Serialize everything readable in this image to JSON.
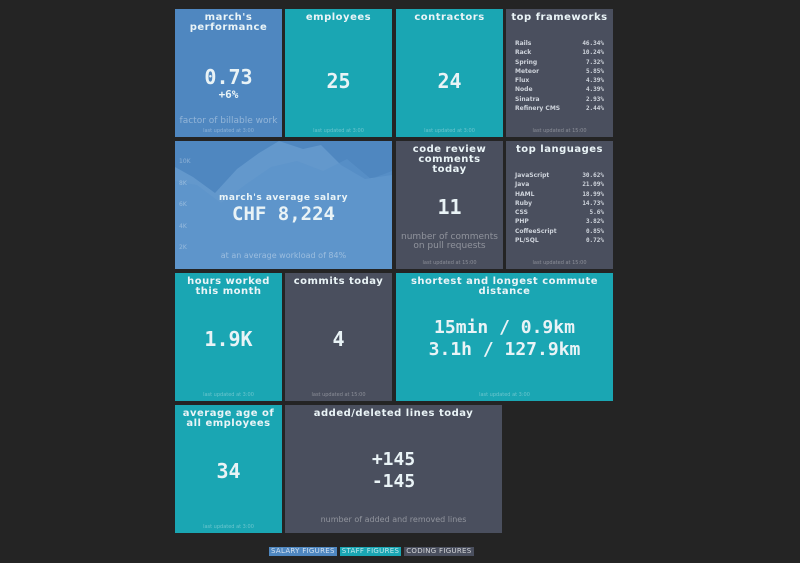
{
  "colors": {
    "salary": "#4f87c0",
    "staff": "#1aa6b3",
    "coding": "#4a4f5e",
    "background": "#242424"
  },
  "performance": {
    "title": "March's Performance",
    "value": "0.73",
    "change": "+6%",
    "moreinfo": "Factor of billable work",
    "updated": "Last updated at 3:00"
  },
  "employees": {
    "title": "Employees",
    "value": "25",
    "updated": "Last updated at 3:00"
  },
  "contractors": {
    "title": "Contractors",
    "value": "24",
    "updated": "Last updated at 3:00"
  },
  "frameworks": {
    "title": "Top Frameworks",
    "items": [
      {
        "label": "Rails",
        "value": "46.34%"
      },
      {
        "label": "Rack",
        "value": "10.24%"
      },
      {
        "label": "Spring",
        "value": "7.32%"
      },
      {
        "label": "Meteor",
        "value": "5.85%"
      },
      {
        "label": "Flux",
        "value": "4.39%"
      },
      {
        "label": "Node",
        "value": "4.39%"
      },
      {
        "label": "Sinatra",
        "value": "2.93%"
      },
      {
        "label": "Refinery CMS",
        "value": "2.44%"
      }
    ],
    "updated": "Last updated at 15:00"
  },
  "salary": {
    "title": "March's average salary",
    "value": "CHF 8,224",
    "moreinfo": "At an average workload of 84%",
    "ticks": [
      "10K",
      "8K",
      "6K",
      "4K",
      "2K"
    ]
  },
  "code_review": {
    "title": "Code review comments today",
    "value": "11",
    "moreinfo": "Number of comments on pull requests",
    "updated": "Last updated at 15:00"
  },
  "languages": {
    "title": "Top Languages",
    "items": [
      {
        "label": "JavaScript",
        "value": "30.62%"
      },
      {
        "label": "Java",
        "value": "21.09%"
      },
      {
        "label": "HAML",
        "value": "18.99%"
      },
      {
        "label": "Ruby",
        "value": "14.73%"
      },
      {
        "label": "CSS",
        "value": "5.6%"
      },
      {
        "label": "PHP",
        "value": "3.82%"
      },
      {
        "label": "CoffeeScript",
        "value": "0.85%"
      },
      {
        "label": "PL/SQL",
        "value": "0.72%"
      }
    ],
    "updated": "Last updated at 15:00"
  },
  "hours": {
    "title": "Hours worked this month",
    "value": "1.9K",
    "updated": "Last updated at 3:00"
  },
  "commits": {
    "title": "Commits today",
    "value": "4",
    "updated": "Last updated at 15:00"
  },
  "commute": {
    "title": "Shortest and longest commute distance",
    "line1": "15min / 0.9km",
    "line2": "3.1h / 127.9km",
    "updated": "Last updated at 3:00"
  },
  "age": {
    "title": "Average age of all employees",
    "value": "34",
    "updated": "Last updated at 3:00"
  },
  "lines": {
    "title": "Added/deleted lines today",
    "added": "+145",
    "deleted": "-145",
    "moreinfo": "Number of added and removed lines"
  },
  "legend": {
    "salary": "Salary figures",
    "staff": "Staff figures",
    "coding": "Coding figures"
  }
}
